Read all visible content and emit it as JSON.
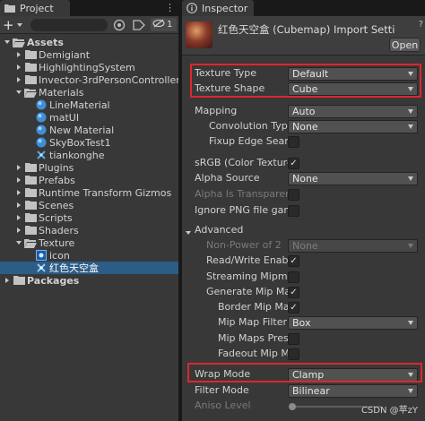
{
  "project": {
    "tab_label": "Project",
    "toolbar": {
      "add_label": "+",
      "hidden_count": "1"
    },
    "tree": [
      {
        "label": "Assets",
        "expanded": true
      },
      {
        "label": "Demigiant"
      },
      {
        "label": "HighlightingSystem"
      },
      {
        "label": "Invector-3rdPersonController_LI"
      },
      {
        "label": "Materials"
      },
      {
        "label": "LineMaterial"
      },
      {
        "label": "matUI"
      },
      {
        "label": "New Material"
      },
      {
        "label": "SkyBoxTest1"
      },
      {
        "label": "tiankonghe"
      },
      {
        "label": "Plugins"
      },
      {
        "label": "Prefabs"
      },
      {
        "label": "Runtime Transform Gizmos"
      },
      {
        "label": "Scenes"
      },
      {
        "label": "Scripts"
      },
      {
        "label": "Shaders"
      },
      {
        "label": "Texture"
      },
      {
        "label": "icon"
      },
      {
        "label": "红色天空盒"
      },
      {
        "label": "Packages"
      }
    ]
  },
  "inspector": {
    "tab_label": "Inspector",
    "title": "红色天空盒 (Cubemap) Import Setti",
    "open_label": "Open",
    "texture_type": {
      "label": "Texture Type",
      "value": "Default"
    },
    "texture_shape": {
      "label": "Texture Shape",
      "value": "Cube"
    },
    "mapping": {
      "label": "Mapping",
      "value": "Auto"
    },
    "convolution_type": {
      "label": "Convolution Type",
      "value": "None"
    },
    "fixup_edge_seams": {
      "label": "Fixup Edge Seams",
      "checked": false
    },
    "srgb": {
      "label": "sRGB (Color Texture)",
      "checked": true
    },
    "alpha_source": {
      "label": "Alpha Source",
      "value": "None"
    },
    "alpha_transparency": {
      "label": "Alpha Is Transparenc",
      "checked": false
    },
    "ignore_png": {
      "label": "Ignore PNG file gamm",
      "checked": false
    },
    "advanced": {
      "label": "Advanced"
    },
    "non_power_of_2": {
      "label": "Non-Power of 2",
      "value": "None"
    },
    "read_write": {
      "label": "Read/Write Enable",
      "checked": true
    },
    "streaming_mipmaps": {
      "label": "Streaming Mipmap",
      "checked": false
    },
    "generate_mipmaps": {
      "label": "Generate Mip Map",
      "checked": true
    },
    "border_mipmaps": {
      "label": "Border Mip Map",
      "checked": true
    },
    "mipmap_filtering": {
      "label": "Mip Map Filterin",
      "value": "Box"
    },
    "mipmaps_preserve": {
      "label": "Mip Maps Prese",
      "checked": false
    },
    "fadeout_mipmaps": {
      "label": "Fadeout Mip Ma",
      "checked": false
    },
    "wrap_mode": {
      "label": "Wrap Mode",
      "value": "Clamp"
    },
    "filter_mode": {
      "label": "Filter Mode",
      "value": "Bilinear"
    },
    "aniso_level": {
      "label": "Aniso Level"
    },
    "watermark": "CSDN @苹zY"
  },
  "colors": {
    "panel_bg": "#383838",
    "selection": "#2c5d87",
    "highlight_border": "#e0262d",
    "folder": "#c2c2c2"
  }
}
